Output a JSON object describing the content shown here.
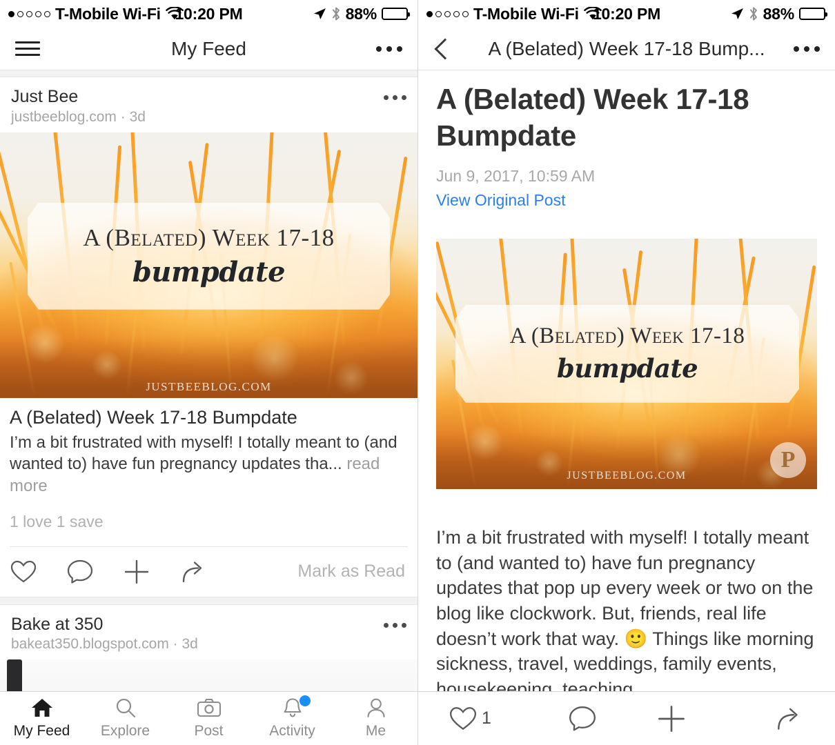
{
  "status_bar": {
    "signal_dots": 5,
    "signal_filled": 1,
    "carrier": "T-Mobile Wi-Fi",
    "wifi_icon": "wifi-icon",
    "time": "10:20 PM",
    "location_icon": "location-arrow-icon",
    "bluetooth_icon": "bluetooth-icon",
    "battery_percent": "88%",
    "battery_level": 88
  },
  "left_panel": {
    "nav": {
      "menu_icon": "hamburger-menu-icon",
      "title": "My Feed",
      "more_icon": "more-options-icon"
    },
    "posts": [
      {
        "source_name": "Just Bee",
        "source_meta": "justbeeblog.com · 3d",
        "more_icon": "more-options-icon",
        "image": {
          "alt": "Sunset wheat field",
          "overlay_line1": "A (Belated) Week 17-18",
          "overlay_line2": "bumpdate",
          "watermark": "JUSTBEEBLOG.COM"
        },
        "title": "A (Belated) Week 17-18 Bumpdate",
        "excerpt": "I’m a bit frustrated with myself! I totally meant to (and wanted to) have fun pregnancy updates tha...",
        "read_more": "read more",
        "stats": "1 love  1 save",
        "actions": {
          "love_icon": "heart-icon",
          "comment_icon": "comment-bubble-icon",
          "add_icon": "plus-icon",
          "share_icon": "share-arrow-icon",
          "mark_as_read": "Mark as Read"
        }
      },
      {
        "source_name": "Bake at 350",
        "source_meta": "bakeat350.blogspot.com · 3d",
        "more_icon": "more-options-icon"
      }
    ],
    "tabbar": [
      {
        "label": "My Feed",
        "icon": "home-icon",
        "active": true,
        "badge": false
      },
      {
        "label": "Explore",
        "icon": "search-icon",
        "active": false,
        "badge": false
      },
      {
        "label": "Post",
        "icon": "camera-icon",
        "active": false,
        "badge": false
      },
      {
        "label": "Activity",
        "icon": "bell-icon",
        "active": false,
        "badge": true
      },
      {
        "label": "Me",
        "icon": "person-icon",
        "active": false,
        "badge": false
      }
    ]
  },
  "right_panel": {
    "nav": {
      "back_icon": "back-chevron-icon",
      "title": "A (Belated) Week 17-18 Bump...",
      "more_icon": "more-options-icon"
    },
    "article": {
      "title": "A (Belated) Week 17-18 Bumpdate",
      "date": "Jun 9, 2017, 10:59 AM",
      "link_label": "View Original Post",
      "image": {
        "alt": "Sunset wheat field",
        "overlay_line1": "A (Belated) Week 17-18",
        "overlay_line2": "bumpdate",
        "watermark": "JUSTBEEBLOG.COM",
        "pin_icon": "pinterest-save-icon",
        "pin_glyph": "P"
      },
      "body": "I’m a bit frustrated with myself! I totally meant to (and wanted to) have fun pregnancy updates that pop up every week or two on the blog like clockwork. But, friends, real life doesn’t work that way. 🙂 Things like morning sickness, travel, weddings, family events, housekeeping, teaching"
    },
    "bottombar": {
      "love_icon": "heart-icon",
      "love_count": "1",
      "comment_icon": "comment-bubble-icon",
      "add_icon": "plus-icon",
      "share_icon": "share-arrow-icon"
    }
  },
  "colors": {
    "accent_link": "#2a7ff0",
    "badge": "#1d8ef6",
    "text_primary": "#2b2b2b",
    "text_muted": "#a8a8a8"
  }
}
